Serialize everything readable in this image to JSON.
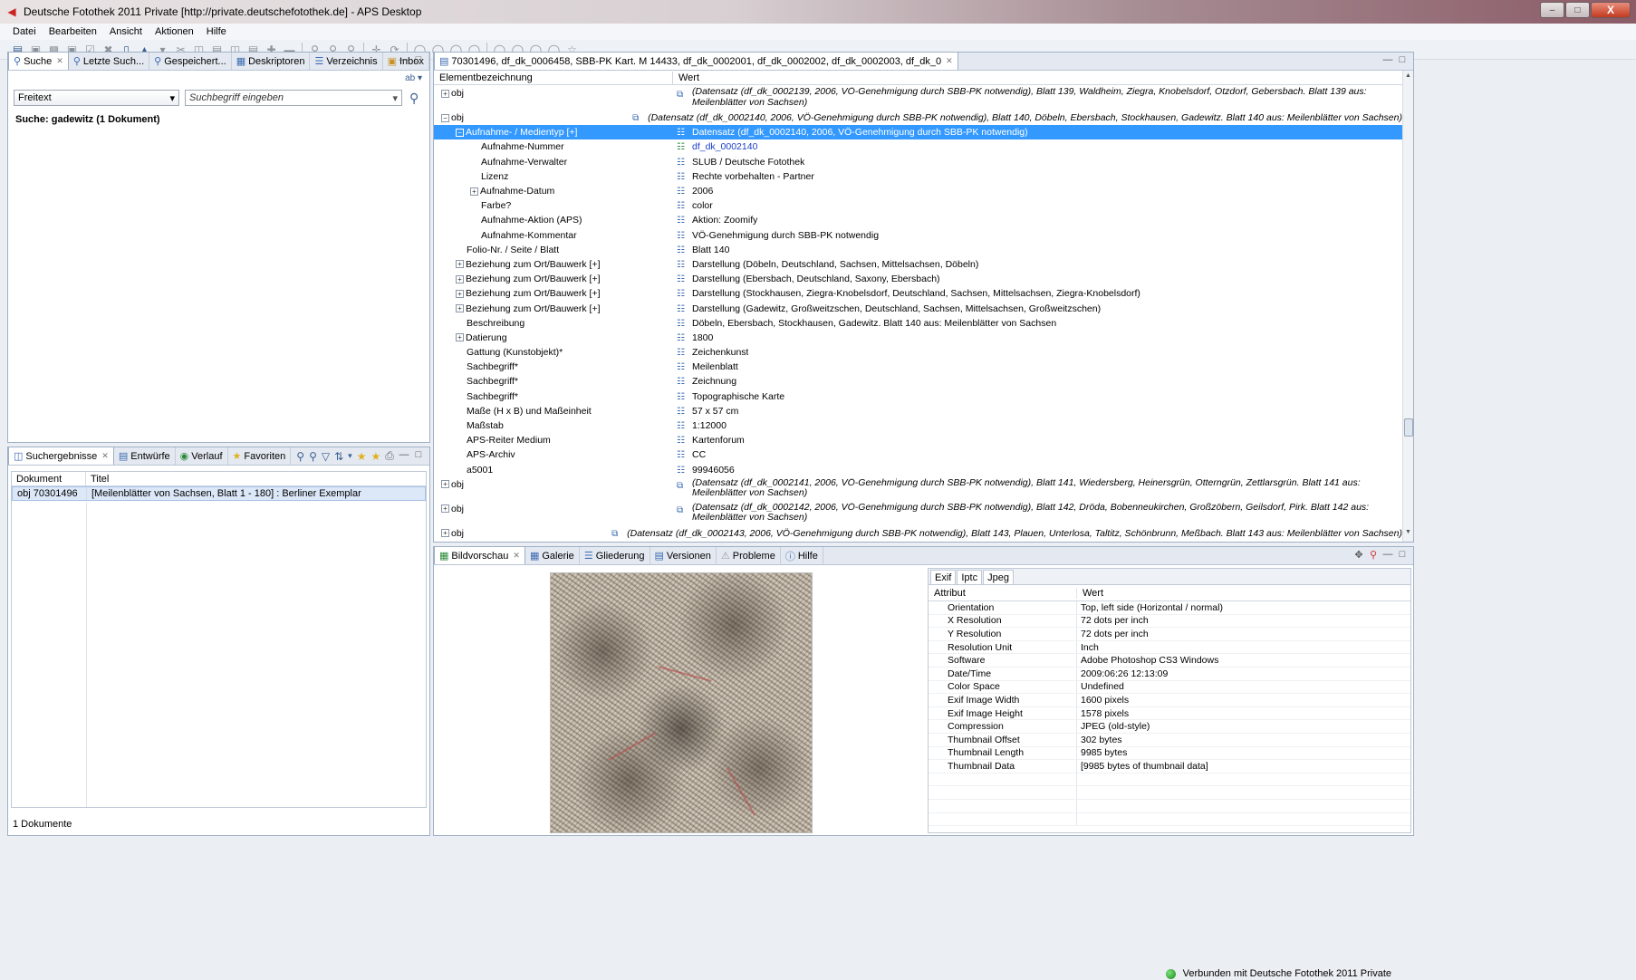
{
  "window": {
    "title": "Deutsche Fotothek 2011 Private [http://private.deutschefotothek.de] - APS Desktop",
    "min_label": "–",
    "max_label": "□",
    "close_label": "X"
  },
  "menu": [
    "Datei",
    "Bearbeiten",
    "Ansicht",
    "Aktionen",
    "Hilfe"
  ],
  "search_panel": {
    "tabs": [
      {
        "label": "Suche",
        "icon": "magnifier-icon"
      },
      {
        "label": "Letzte Such...",
        "icon": "search-history-icon"
      },
      {
        "label": "Gespeichert...",
        "icon": "saved-search-icon"
      },
      {
        "label": "Deskriptoren",
        "icon": "descriptor-icon"
      },
      {
        "label": "Verzeichnis",
        "icon": "directory-icon"
      },
      {
        "label": "Inbox",
        "icon": "inbox-icon"
      }
    ],
    "ab_label": "ab",
    "field_select": "Freitext",
    "search_placeholder": "Suchbegriff eingeben",
    "summary": "Suche:  gadewitz (1 Dokument)"
  },
  "results_panel": {
    "tabs": [
      {
        "label": "Suchergebnisse",
        "icon": "results-icon"
      },
      {
        "label": "Entwürfe",
        "icon": "drafts-icon"
      },
      {
        "label": "Verlauf",
        "icon": "history-icon"
      },
      {
        "label": "Favoriten",
        "icon": "star-icon"
      }
    ],
    "columns": [
      "Dokument",
      "Titel"
    ],
    "rows": [
      {
        "dokument": "obj 70301496",
        "titel": "[Meilenblätter von Sachsen, Blatt 1 - 180] : Berliner Exemplar"
      }
    ],
    "footer": "1 Dokumente"
  },
  "tree_panel": {
    "tab_label": "70301496, df_dk_0006458, SBB-PK Kart. M 14433, df_dk_0002001, df_dk_0002002, df_dk_0002003, df_dk_0",
    "columns": [
      "Elementbezeichnung",
      "Wert"
    ],
    "rows": [
      {
        "name": "obj",
        "indent": 1,
        "exp": "+",
        "value": "(Datensatz (df_dk_0002139, 2006, VÖ-Genehmigung durch SBB-PK notwendig), Blatt 139, Waldheim, Ziegra, Knobelsdorf, Otzdorf, Gebersbach. Blatt 139 aus: Meilenblätter von Sachsen)",
        "tall": true,
        "icon": "record-link-icon"
      },
      {
        "name": "obj",
        "indent": 1,
        "exp": "−",
        "value": "(Datensatz (df_dk_0002140, 2006, VÖ-Genehmigung durch SBB-PK notwendig), Blatt 140, Döbeln, Ebersbach, Stockhausen, Gadewitz. Blatt 140 aus: Meilenblätter von Sachsen)",
        "tall": false,
        "italic": true,
        "icon": "record-link-icon"
      },
      {
        "name": "Aufnahme- / Medientyp [+]",
        "indent": 2,
        "exp": "−",
        "value": "Datensatz (df_dk_0002140, 2006, VÖ-Genehmigung durch SBB-PK notwendig)",
        "selected": true,
        "icon": "document-icon"
      },
      {
        "name": "Aufnahme-Nummer",
        "indent": 3,
        "value": "df_dk_0002140",
        "link": true,
        "icon": "document-icon"
      },
      {
        "name": "Aufnahme-Verwalter",
        "indent": 3,
        "value": "SLUB / Deutsche Fotothek",
        "icon": "document-icon"
      },
      {
        "name": "Lizenz",
        "indent": 3,
        "value": "Rechte vorbehalten - Partner",
        "icon": "document-icon"
      },
      {
        "name": "Aufnahme-Datum",
        "indent": 3,
        "exp": "+",
        "value": "2006",
        "icon": "document-icon"
      },
      {
        "name": "Farbe?",
        "indent": 3,
        "value": "color",
        "icon": "document-icon"
      },
      {
        "name": "Aufnahme-Aktion (APS)",
        "indent": 3,
        "value": "Aktion: Zoomify",
        "icon": "document-icon"
      },
      {
        "name": "Aufnahme-Kommentar",
        "indent": 3,
        "value": "VÖ-Genehmigung durch SBB-PK notwendig",
        "icon": "document-icon"
      },
      {
        "name": "Folio-Nr. / Seite / Blatt",
        "indent": 2,
        "value": "Blatt 140",
        "icon": "document-icon"
      },
      {
        "name": "Beziehung zum Ort/Bauwerk [+]",
        "indent": 2,
        "exp": "+",
        "value": "Darstellung (Döbeln, Deutschland, Sachsen, Mittelsachsen, Döbeln)",
        "icon": "document-icon"
      },
      {
        "name": "Beziehung zum Ort/Bauwerk [+]",
        "indent": 2,
        "exp": "+",
        "value": "Darstellung (Ebersbach, Deutschland, Saxony, Ebersbach)",
        "icon": "document-icon"
      },
      {
        "name": "Beziehung zum Ort/Bauwerk [+]",
        "indent": 2,
        "exp": "+",
        "value": "Darstellung (Stockhausen, Ziegra-Knobelsdorf, Deutschland, Sachsen, Mittelsachsen, Ziegra-Knobelsdorf)",
        "icon": "document-icon"
      },
      {
        "name": "Beziehung zum Ort/Bauwerk [+]",
        "indent": 2,
        "exp": "+",
        "value": "Darstellung (Gadewitz, Großweitzschen, Deutschland, Sachsen, Mittelsachsen, Großweitzschen)",
        "icon": "document-icon"
      },
      {
        "name": "Beschreibung",
        "indent": 2,
        "value": "Döbeln, Ebersbach, Stockhausen, Gadewitz. Blatt 140 aus: Meilenblätter von Sachsen",
        "icon": "document-icon"
      },
      {
        "name": "Datierung",
        "indent": 2,
        "exp": "+",
        "value": "1800",
        "icon": "document-icon"
      },
      {
        "name": "Gattung (Kunstobjekt)*",
        "indent": 2,
        "value": "Zeichenkunst",
        "icon": "document-icon"
      },
      {
        "name": "Sachbegriff*",
        "indent": 2,
        "value": "Meilenblatt",
        "icon": "document-icon"
      },
      {
        "name": "Sachbegriff*",
        "indent": 2,
        "value": "Zeichnung",
        "icon": "document-icon"
      },
      {
        "name": "Sachbegriff*",
        "indent": 2,
        "value": "Topographische Karte",
        "icon": "document-icon"
      },
      {
        "name": "Maße (H x B) und Maßeinheit",
        "indent": 2,
        "value": "57 x 57 cm",
        "icon": "document-icon"
      },
      {
        "name": "Maßstab",
        "indent": 2,
        "value": "1:12000",
        "icon": "document-icon"
      },
      {
        "name": "APS-Reiter Medium",
        "indent": 2,
        "value": "Kartenforum",
        "icon": "document-icon"
      },
      {
        "name": "APS-Archiv",
        "indent": 2,
        "value": "CC",
        "icon": "document-icon"
      },
      {
        "name": "a5001",
        "indent": 2,
        "value": "99946056",
        "icon": "document-icon"
      },
      {
        "name": "obj",
        "indent": 1,
        "exp": "+",
        "value": "(Datensatz (df_dk_0002141, 2006, VÖ-Genehmigung durch SBB-PK notwendig), Blatt 141, Wiedersberg, Heinersgrün, Otterngrün, Zettlarsgrün. Blatt 141 aus: Meilenblätter von Sachsen)",
        "tall": true,
        "icon": "record-link-icon"
      },
      {
        "name": "obj",
        "indent": 1,
        "exp": "+",
        "value": "(Datensatz (df_dk_0002142, 2006, VÖ-Genehmigung durch SBB-PK notwendig), Blatt 142, Dröda, Bobenneukirchen, Großzöbern, Geilsdorf, Pirk. Blatt 142 aus: Meilenblätter von Sachsen)",
        "tall": true,
        "icon": "record-link-icon"
      },
      {
        "name": "obj",
        "indent": 1,
        "exp": "+",
        "value": "(Datensatz (df_dk_0002143, 2006, VÖ-Genehmigung durch SBB-PK notwendig), Blatt 143, Plauen, Unterlosa, Taltitz, Schönbrunn, Meßbach. Blatt 143 aus: Meilenblätter von Sachsen)",
        "tall": false,
        "italic": true,
        "icon": "record-link-icon"
      }
    ]
  },
  "preview_panel": {
    "tabs": [
      {
        "label": "Bildvorschau",
        "icon": "image-icon"
      },
      {
        "label": "Galerie",
        "icon": "gallery-icon"
      },
      {
        "label": "Gliederung",
        "icon": "outline-icon"
      },
      {
        "label": "Versionen",
        "icon": "versions-icon"
      },
      {
        "label": "Probleme",
        "icon": "warning-icon"
      },
      {
        "label": "Hilfe",
        "icon": "help-icon"
      }
    ],
    "exif_tabs": [
      "Exif",
      "Iptc",
      "Jpeg"
    ],
    "exif_columns": [
      "Attribut",
      "Wert"
    ],
    "exif_rows": [
      {
        "a": "Orientation",
        "v": "Top, left side (Horizontal / normal)"
      },
      {
        "a": "X Resolution",
        "v": "72 dots per inch"
      },
      {
        "a": "Y Resolution",
        "v": "72 dots per inch"
      },
      {
        "a": "Resolution Unit",
        "v": "Inch"
      },
      {
        "a": "Software",
        "v": "Adobe Photoshop CS3 Windows"
      },
      {
        "a": "Date/Time",
        "v": "2009:06:26 12:13:09"
      },
      {
        "a": "Color Space",
        "v": "Undefined"
      },
      {
        "a": "Exif Image Width",
        "v": "1600 pixels"
      },
      {
        "a": "Exif Image Height",
        "v": "1578 pixels"
      },
      {
        "a": "Compression",
        "v": "JPEG (old-style)"
      },
      {
        "a": "Thumbnail Offset",
        "v": "302 bytes"
      },
      {
        "a": "Thumbnail Length",
        "v": "9985 bytes"
      },
      {
        "a": "Thumbnail Data",
        "v": "[9985 bytes of thumbnail data]"
      }
    ]
  },
  "status": {
    "text": "Verbunden mit Deutsche Fotothek 2011 Private"
  }
}
